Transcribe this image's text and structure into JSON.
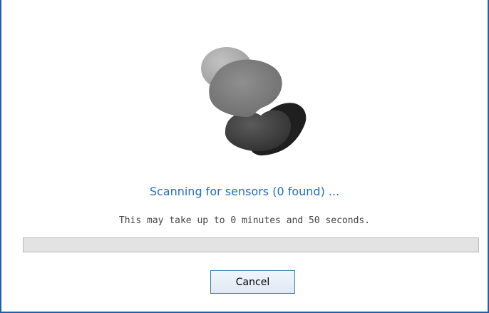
{
  "dialog": {
    "status_text": "Scanning for sensors (0 found) ...",
    "sub_text": "This may take up to 0 minutes and 50 seconds.",
    "progress": 0,
    "cancel_label": "Cancel",
    "spinner_icon": "loading-spinner-icon",
    "colors": {
      "border": "#1f5fae",
      "status_text": "#1e6fc4",
      "progress_track": "#e3e3e3"
    }
  }
}
